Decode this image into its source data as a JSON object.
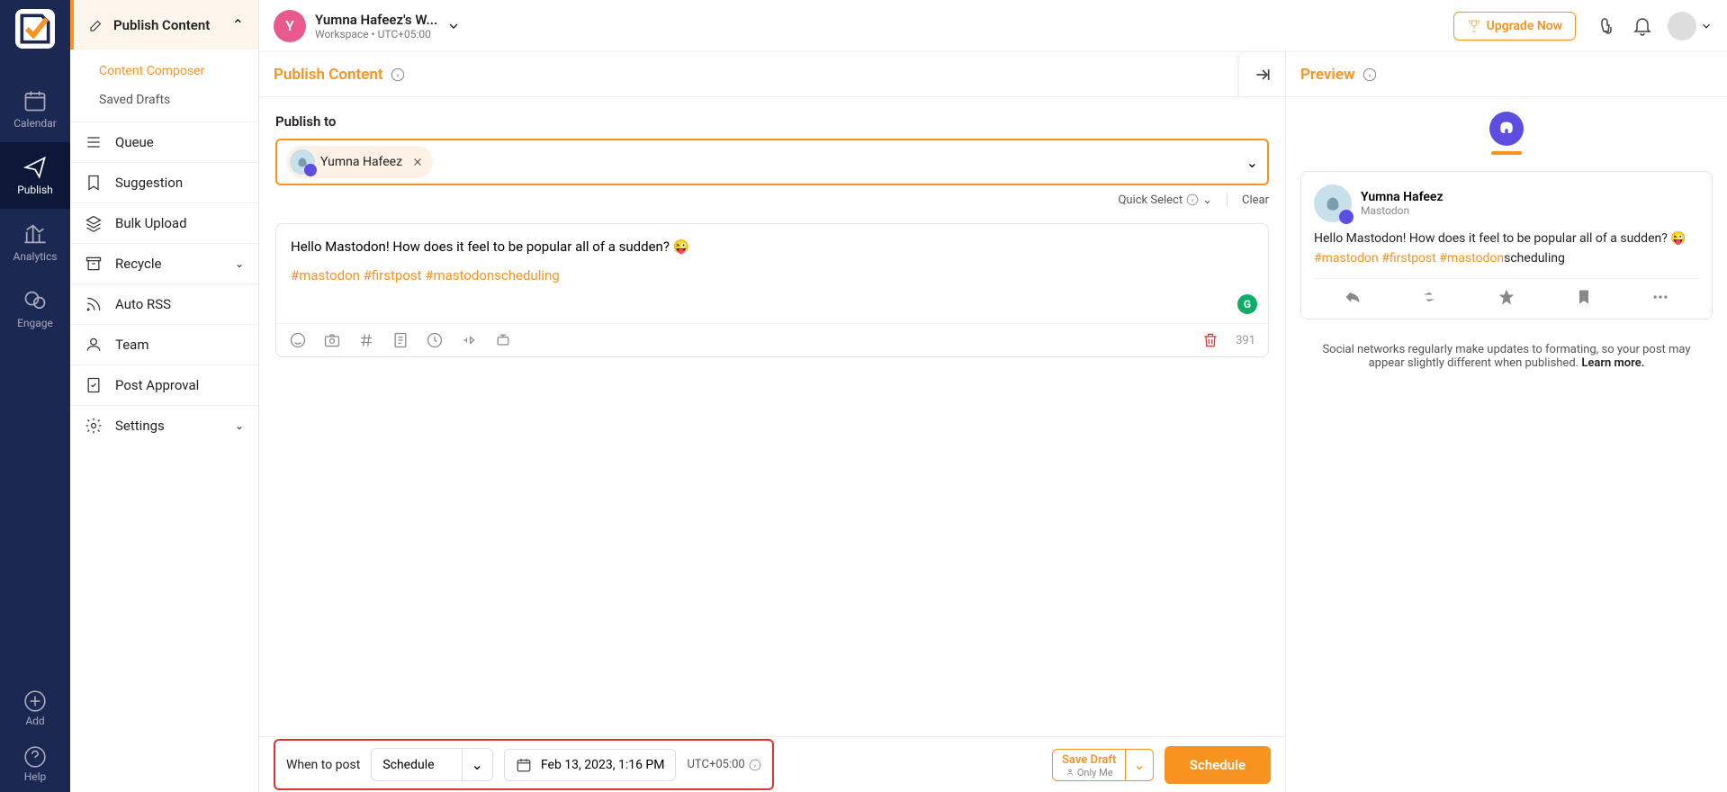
{
  "rail": {
    "calendar": "Calendar",
    "publish": "Publish",
    "analytics": "Analytics",
    "engage": "Engage",
    "add": "Add",
    "help": "Help"
  },
  "secnav": {
    "header": "Publish Content",
    "composer": "Content Composer",
    "drafts": "Saved Drafts",
    "queue": "Queue",
    "suggestion": "Suggestion",
    "bulk": "Bulk Upload",
    "recycle": "Recycle",
    "autorss": "Auto RSS",
    "team": "Team",
    "approval": "Post Approval",
    "settings": "Settings"
  },
  "topbar": {
    "ws_initial": "Y",
    "ws_name": "Yumna Hafeez's W...",
    "ws_meta": "Workspace • UTC+05:00",
    "upgrade": "Upgrade Now"
  },
  "composer": {
    "title": "Publish Content",
    "publish_to": "Publish to",
    "account_name": "Yumna Hafeez",
    "quick_select": "Quick Select",
    "clear": "Clear",
    "body_text": "Hello Mastodon! How does it feel to be popular all of a sudden? 😜",
    "hashtags": "#mastodon #firstpost #mastodonscheduling",
    "char_count": "391"
  },
  "preview": {
    "title": "Preview",
    "name": "Yumna Hafeez",
    "network": "Mastodon",
    "text": "Hello Mastodon! How does it feel to be popular all of a sudden? 😜",
    "hash1": "#mastodon",
    "hash2": "#firstpost",
    "hash3": "#mastodon",
    "hash_tail": "scheduling",
    "note_text": "Social networks regularly make updates to formating, so your post may appear slightly different when published. ",
    "note_link": "Learn more."
  },
  "footer": {
    "when_label": "When to post",
    "schedule_value": "Schedule",
    "date_value": "Feb 13, 2023, 1:16 PM",
    "tz": "UTC+05:00",
    "save_draft": "Save Draft",
    "only_me": "Only Me",
    "schedule_btn": "Schedule"
  }
}
